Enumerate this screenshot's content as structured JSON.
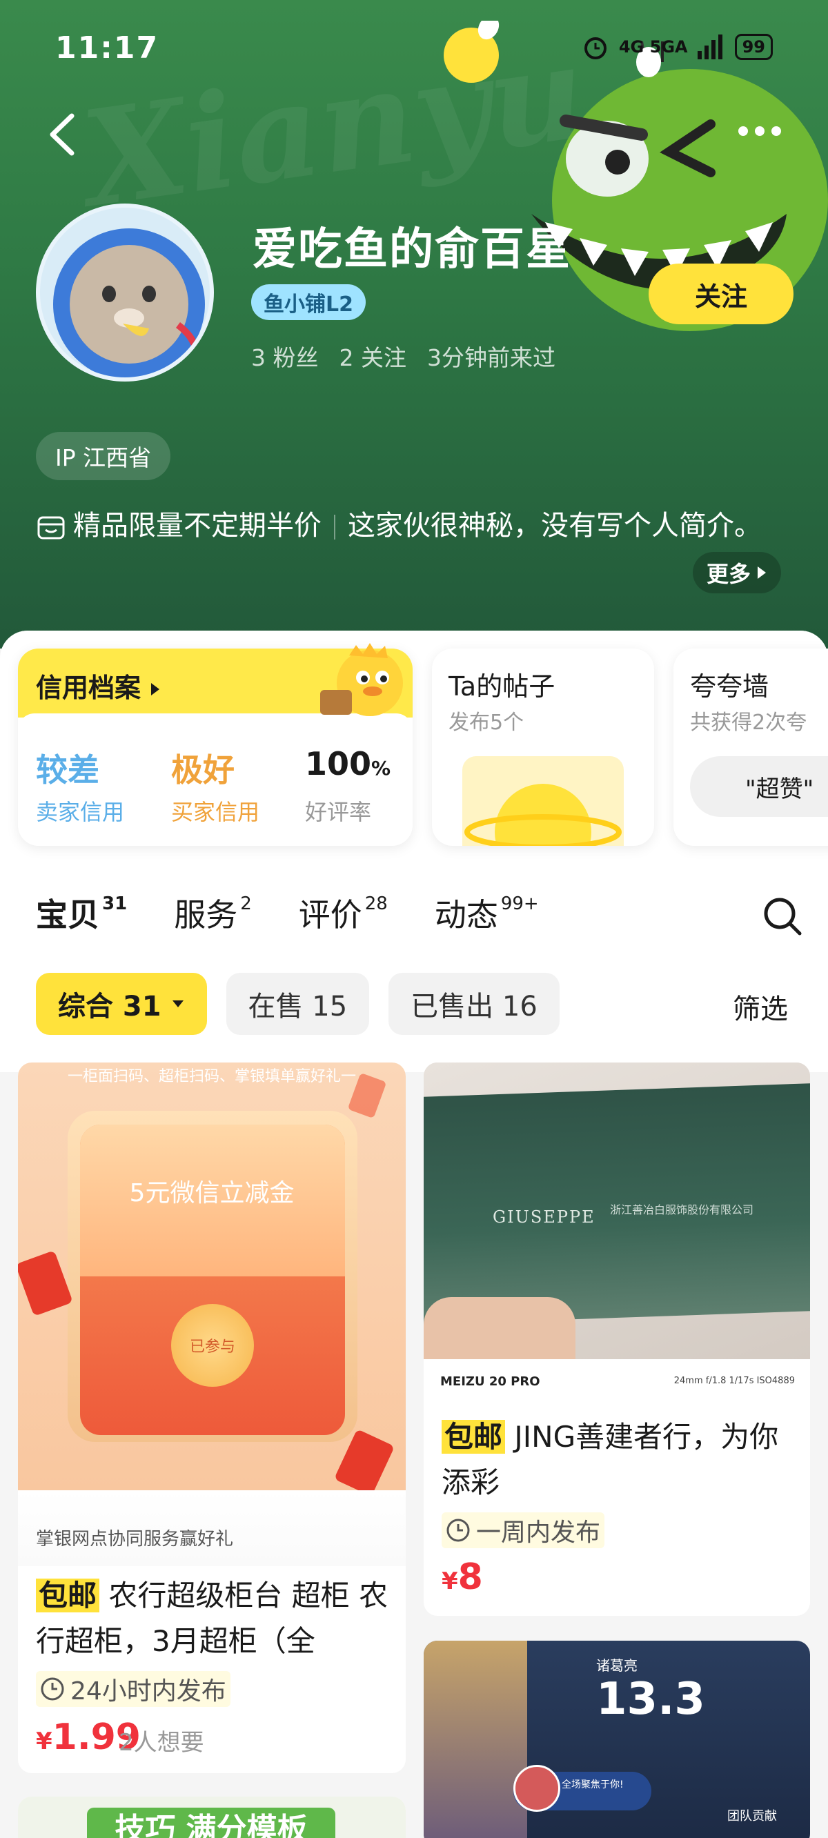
{
  "status_bar": {
    "time": "11:17",
    "network": "4G 5GA",
    "battery": "99"
  },
  "profile": {
    "name": "爱吃鱼的俞百星",
    "badge": "鱼小铺L2",
    "stats": [
      "3 粉丝",
      "2 关注",
      "3分钟前来过"
    ],
    "follow_label": "关注",
    "ip": "IP 江西省",
    "intro_part1": "精品限量不定期半价",
    "intro_part2": "这家伙很神秘，没有写个人简介。",
    "more_label": "更多",
    "bg_text": "Xianyu"
  },
  "credit": {
    "title": "信用档案",
    "seller_credit_value": "较差",
    "seller_credit_label": "卖家信用",
    "buyer_credit_value": "极好",
    "buyer_credit_label": "买家信用",
    "rating_value": "100",
    "rating_unit": "%",
    "rating_label": "好评率",
    "colors": {
      "poor": "#5aaee8",
      "good": "#f0a23a"
    }
  },
  "posts": {
    "title": "Ta的帖子",
    "sub": "发布5个"
  },
  "praise": {
    "title": "夸夸墙",
    "sub": "共获得2次夸",
    "tag": "\"超赞\""
  },
  "tabs": [
    {
      "label": "宝贝",
      "count": "31"
    },
    {
      "label": "服务",
      "count": "2"
    },
    {
      "label": "评价",
      "count": "28"
    },
    {
      "label": "动态",
      "count": "99+"
    }
  ],
  "filters": {
    "chips": [
      "综合 31",
      "在售 15",
      "已售出 16"
    ],
    "filter_label": "筛选"
  },
  "products": [
    {
      "banner_top": "一柜面扫码、超柜扫码、掌银填单赢好礼一",
      "banner_main": "5元微信立减金",
      "banner_stamp": "已参与",
      "banner_bottom": "掌银网点协同服务赢好礼",
      "ship": "包邮",
      "title": "农行超级柜台 超柜 农行超柜，3月超柜（全",
      "time": "24小时内发布",
      "currency": "¥",
      "price": "1.99",
      "want": "2人想要"
    },
    {
      "photo_brand": "GIUSEPPE",
      "photo_text": "浙江善冶白服饰股份有限公司",
      "camera_model": "MEIZU 20 PRO",
      "camera_info": "24mm f/1.8 1/17s ISO4889",
      "ship": "包邮",
      "title": "JING善建者行，为你添彩",
      "time": "一周内发布",
      "currency": "¥",
      "price": "8"
    },
    {
      "game_score": "13.3",
      "game_label": "诸葛亮",
      "mvp_text": "全场聚焦于你!",
      "team_label": "团队贡献"
    },
    {
      "title_partial": "技巧 满分模板"
    }
  ]
}
